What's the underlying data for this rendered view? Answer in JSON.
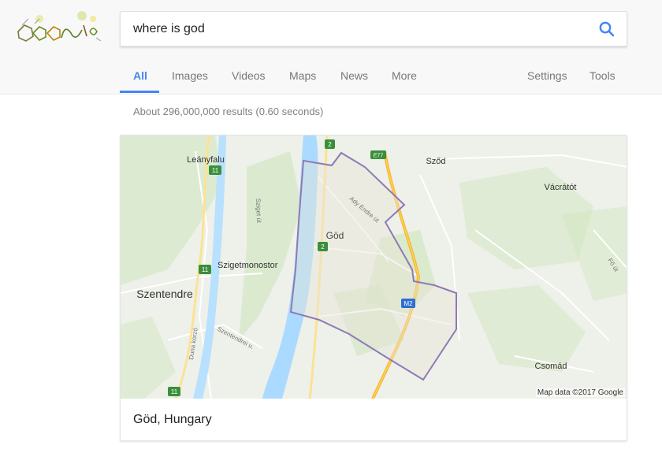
{
  "search": {
    "query": "where is god"
  },
  "tabs": [
    {
      "label": "All",
      "active": true
    },
    {
      "label": "Images"
    },
    {
      "label": "Videos"
    },
    {
      "label": "Maps"
    },
    {
      "label": "News"
    },
    {
      "label": "More"
    }
  ],
  "tools": {
    "settings_label": "Settings",
    "tools_label": "Tools"
  },
  "results": {
    "stats": "About 296,000,000 results (0.60 seconds)"
  },
  "map_card": {
    "place_name": "Göd, Hungary",
    "attribution": "Map data ©2017 Google",
    "labels": {
      "leanyfalu": "Leányfalu",
      "szod": "Sződ",
      "vacratot": "Vácrátót",
      "god": "Göd",
      "szigetmonostor": "Szigetmonostor",
      "szentendre": "Szentendre",
      "csomad": "Csomád",
      "ady_endre": "Ady Endre út",
      "sziget_ut": "Sziget út",
      "szentendrei_u": "Szentendrei u.",
      "duna_korzo": "Duna korzó",
      "fo_ut": "Fő út"
    },
    "shields": {
      "route_11": "11",
      "route_2": "2",
      "e77": "E77",
      "m2": "M2"
    }
  },
  "colors": {
    "accent": "#4285f4",
    "river": "#aadaff",
    "green": "#c8e6b0",
    "road_major": "#f6b73c",
    "boundary": "#8e7ab5"
  }
}
